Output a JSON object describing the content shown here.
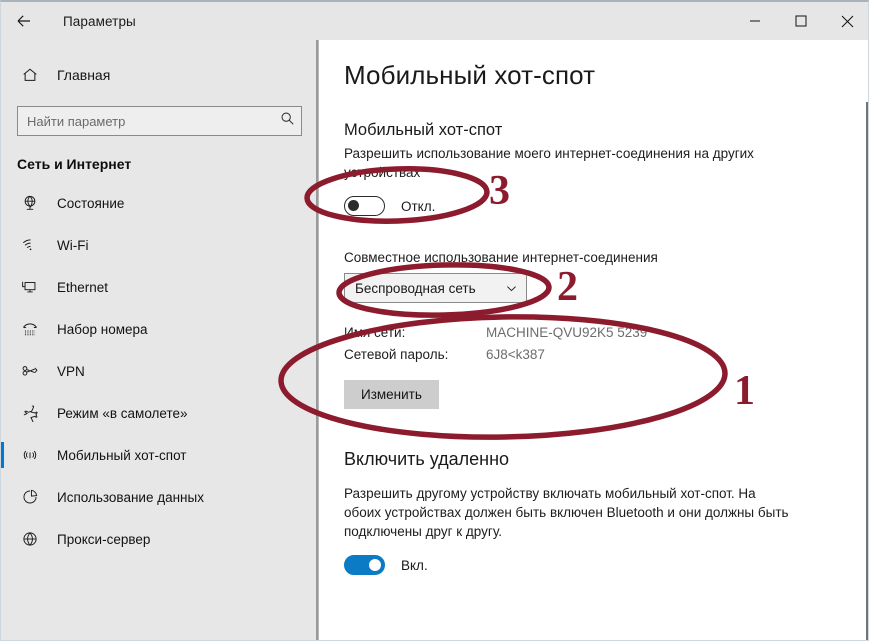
{
  "window": {
    "title": "Параметры",
    "back_icon": "back-arrow-icon",
    "minimize_label": "—",
    "maximize_label": "▢",
    "close_label": "✕"
  },
  "sidebar": {
    "home": {
      "label": "Главная",
      "icon": "home-icon"
    },
    "search": {
      "placeholder": "Найти параметр",
      "value": "",
      "icon": "search-icon"
    },
    "section_title": "Сеть и Интернет",
    "items": [
      {
        "label": "Состояние",
        "icon": "globe-monitor-icon",
        "selected": false
      },
      {
        "label": "Wi-Fi",
        "icon": "wifi-icon",
        "selected": false
      },
      {
        "label": "Ethernet",
        "icon": "ethernet-icon",
        "selected": false
      },
      {
        "label": "Набор номера",
        "icon": "dialup-phone-icon",
        "selected": false
      },
      {
        "label": "VPN",
        "icon": "vpn-key-icon",
        "selected": false
      },
      {
        "label": "Режим «в самолете»",
        "icon": "airplane-icon",
        "selected": false
      },
      {
        "label": "Мобильный хот-спот",
        "icon": "hotspot-broadcast-icon",
        "selected": true
      },
      {
        "label": "Использование данных",
        "icon": "pie-chart-icon",
        "selected": false
      },
      {
        "label": "Прокси-сервер",
        "icon": "globe-icon",
        "selected": false
      }
    ]
  },
  "main": {
    "page_title": "Мобильный хот-спот",
    "hotspot_section": {
      "heading": "Мобильный хот-спот",
      "description": "Разрешить использование моего интернет-соединения на других устройствах",
      "toggle_state": "off",
      "toggle_label": "Откл."
    },
    "sharing": {
      "label": "Совместное использование интернет-соединения",
      "selected_option": "Беспроводная сеть",
      "chevron_icon": "chevron-down-icon"
    },
    "network_info": {
      "rows": [
        {
          "key": "Имя сети:",
          "value": "MACHINE-QVU92K5 5239"
        },
        {
          "key": "Сетевой пароль:",
          "value": "6J8<k387"
        }
      ],
      "edit_button": "Изменить"
    },
    "remote_section": {
      "heading": "Включить удаленно",
      "description": "Разрешить другому устройству включать мобильный хот-спот. На обоих устройствах должен быть включен Bluetooth и они должны быть подключены друг к другу.",
      "toggle_state": "on",
      "toggle_label": "Вкл."
    }
  },
  "annotations": {
    "color": "#8c1b2e",
    "markers": [
      {
        "number": "1",
        "target": "network-info-block"
      },
      {
        "number": "2",
        "target": "sharing-dropdown"
      },
      {
        "number": "3",
        "target": "hotspot-toggle"
      }
    ]
  }
}
